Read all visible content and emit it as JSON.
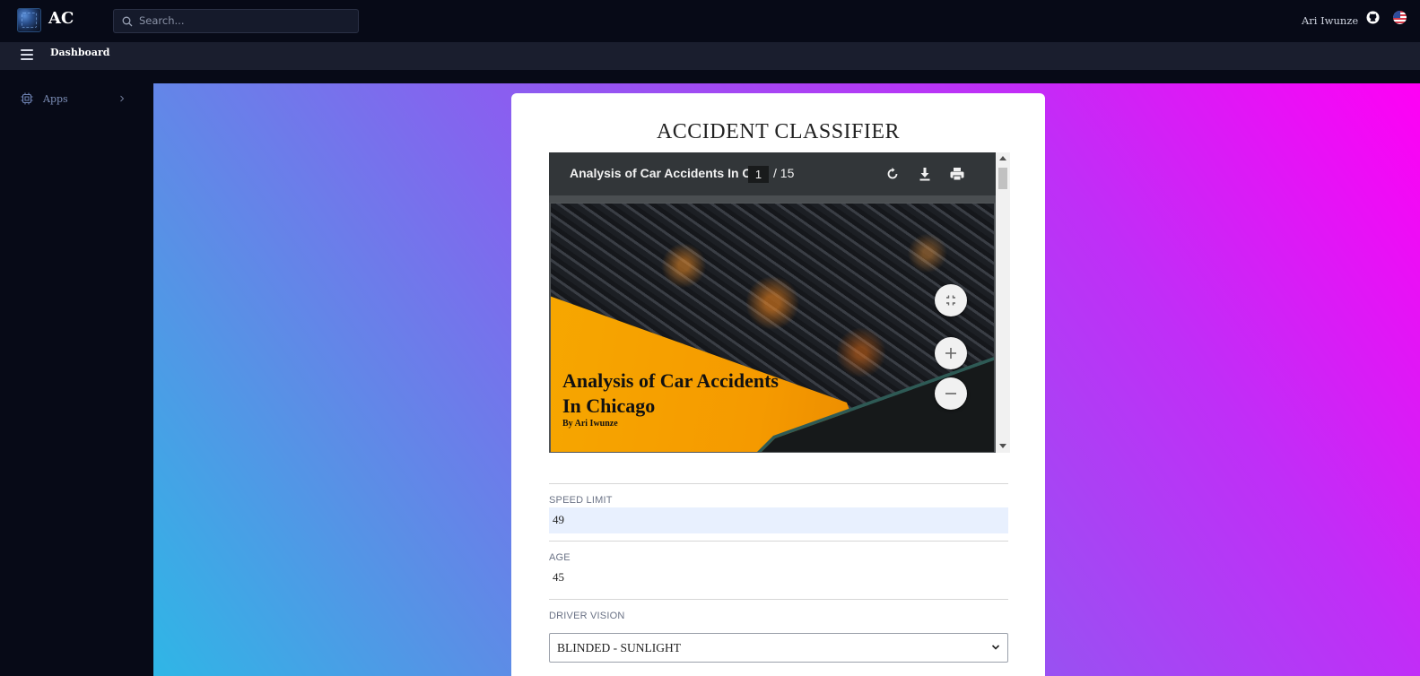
{
  "header": {
    "brand": "AC",
    "search_placeholder": "Search...",
    "user_name": "Ari Iwunze"
  },
  "subbar": {
    "breadcrumb": "Dashboard"
  },
  "sidebar": {
    "items": [
      {
        "label": "Apps",
        "icon": "cpu-icon"
      }
    ]
  },
  "card": {
    "title": "ACCIDENT CLASSIFIER",
    "pdf": {
      "title": "Analysis of Car Accidents In C...",
      "current_page": "1",
      "total_pages": "/ 15",
      "slide_heading": "Analysis of Car Accidents In Chicago",
      "slide_byline": "By Ari Iwunze"
    },
    "form": {
      "speed_limit": {
        "label": "SPEED LIMIT",
        "value": "49"
      },
      "age": {
        "label": "AGE",
        "value": "45"
      },
      "driver_vision": {
        "label": "DRIVER VISION",
        "value": "BLINDED - SUNLIGHT"
      }
    }
  },
  "colors": {
    "background": "#070a17",
    "subbar": "#1a1e2e",
    "gradient_start": "#2fb6e6",
    "gradient_end": "#ff00f5",
    "input_fill": "#e8f0fe"
  }
}
